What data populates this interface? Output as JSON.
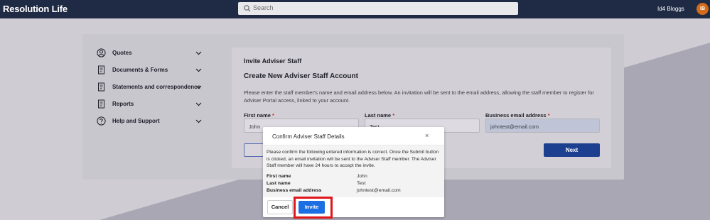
{
  "header": {
    "logo": "Resolution Life",
    "search_placeholder": "Search",
    "user_name": "Id4 Bloggs",
    "user_initials": "IB"
  },
  "colors": {
    "header_bg": "#1f2a44",
    "primary_button": "#1d3f8f",
    "invite_button": "#1c6fe3",
    "avatar": "#d46b1b",
    "highlight": "#e0161b"
  },
  "sidebar": {
    "items": [
      {
        "label": "Quotes",
        "icon": "user-circle-icon"
      },
      {
        "label": "Documents & Forms",
        "icon": "document-icon"
      },
      {
        "label": "Statements and correspondence",
        "icon": "document-icon"
      },
      {
        "label": "Reports",
        "icon": "document-icon"
      },
      {
        "label": "Help and Support",
        "icon": "help-circle-icon"
      }
    ]
  },
  "form": {
    "title": "Invite Adviser Staff",
    "heading": "Create New Adviser Staff Account",
    "description": "Please enter the staff member's name and email address below. An invitation will be sent to the email address, allowing the staff member to register for Adviser Portal access, linked to your account.",
    "first_name_label": "First name",
    "last_name_label": "Last name",
    "email_label": "Business email address",
    "required_mark": "*",
    "first_name_value": "John",
    "last_name_value": "Test",
    "email_value": "johntest@email.com",
    "next_label": "Next"
  },
  "modal": {
    "title": "Confirm Adviser Staff Details",
    "close_symbol": "×",
    "message": "Please confirm the following entered information is correct. Once the Submit button is clicked, an email invitation will be sent to the Adviser Staff member. The Adviser Staff member will have 24 hours to accept the invite.",
    "rows": [
      {
        "key": "First name",
        "value": "John"
      },
      {
        "key": "Last name",
        "value": "Test"
      },
      {
        "key": "Business email address",
        "value": "johntest@email.com"
      }
    ],
    "cancel_label": "Cancel",
    "invite_label": "Invite"
  }
}
